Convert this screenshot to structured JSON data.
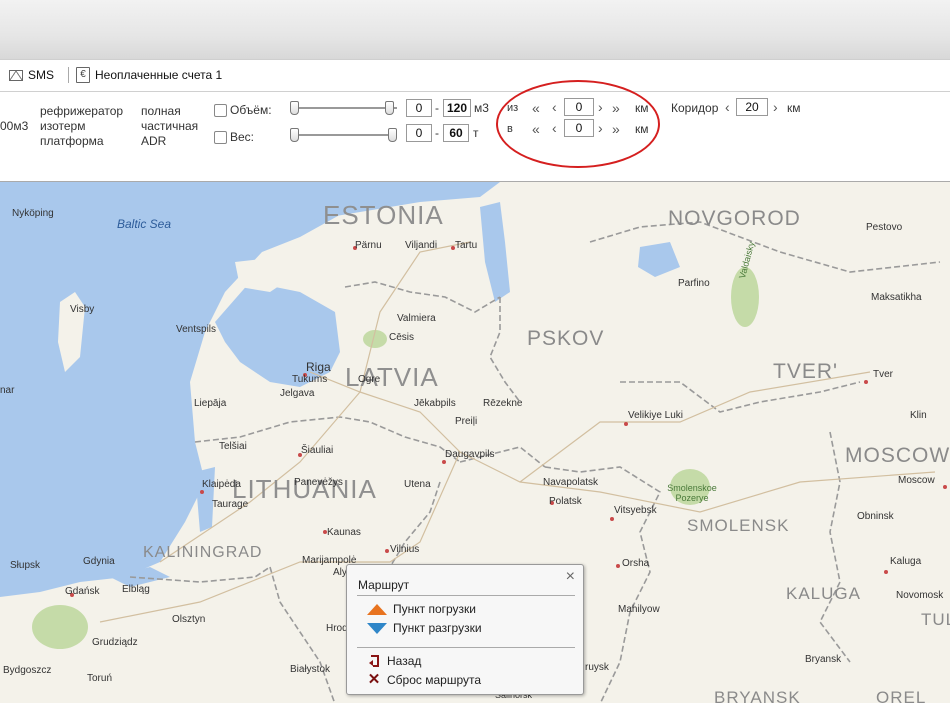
{
  "links": {
    "sms": "SMS",
    "invoices": "Неоплаченные счета 1",
    "euro_icon": "€"
  },
  "filters": {
    "cut_value": "00м3",
    "body_types": [
      "рефрижератор",
      "изотерм",
      "платформа"
    ],
    "load_types": [
      "полная",
      "частичная",
      "ADR"
    ],
    "volume": {
      "label": "Объём:",
      "min": "0",
      "max": "120",
      "unit": "м3"
    },
    "weight": {
      "label": "Вес:",
      "min": "0",
      "max": "60",
      "unit": "т"
    },
    "dash": "-",
    "from": {
      "label": "из",
      "value": "0",
      "unit": "км"
    },
    "to": {
      "label": "в",
      "value": "0",
      "unit": "км"
    },
    "corridor": {
      "label": "Коридор",
      "value": "20",
      "unit": "км"
    }
  },
  "map": {
    "countries": [
      "ESTONIA",
      "LATVIA",
      "LITHUANIA"
    ],
    "regions": [
      "NOVGOROD",
      "PSKOV",
      "TVER'",
      "MOSCOW",
      "SMOLENSK",
      "KALUGA",
      "KALININGRAD",
      "BRYANSK",
      "OREL",
      "TUL"
    ],
    "sea": "Baltic Sea",
    "cities": [
      "Nyköping",
      "Pärnu",
      "Viljandi",
      "Tartu",
      "Pestovo",
      "Parfino",
      "Maksatikha",
      "Visby",
      "Ventspils",
      "Valmiera",
      "Cēsis",
      "Riga",
      "Tukums",
      "Ogre",
      "Jelgava",
      "Liepāja",
      "Jēkabpils",
      "Rēzekne",
      "Preiļi",
      "Velikiye Luki",
      "Tver",
      "Klin",
      "Telšiai",
      "Šiauliai",
      "Daugavpils",
      "Panevėžys",
      "Klaipėda",
      "Utena",
      "Navapolatsk",
      "Polatsk",
      "Vitsyebsk",
      "Taurage",
      "Kaunas",
      "Vilnius",
      "Moscow",
      "Obninsk",
      "Słupsk",
      "Gdynia",
      "Marijampolė",
      "Orsha",
      "Kaluga",
      "Gdańsk",
      "Elbląg",
      "Olsztyn",
      "Mahilyow",
      "Novomosk",
      "Grudziądz",
      "Hrod",
      "Toruń",
      "Bydgoszcz",
      "Białystok",
      "Bryansk",
      "Alyt",
      "ruysk",
      "Salihorsk",
      "nar"
    ],
    "parks": [
      "Valdaisky",
      "Smolenskoe Pozerye"
    ]
  },
  "popup": {
    "title": "Маршрут",
    "close": "×",
    "load_point": "Пункт погрузки",
    "unload_point": "Пункт разгрузки",
    "back": "Назад",
    "reset": "Сброс маршрута"
  },
  "colors": {
    "annotation": "#d51f1f",
    "water": "#a9c8ec",
    "land": "#f4f2ea",
    "load": "#e8731f",
    "unload": "#2f86c8"
  }
}
